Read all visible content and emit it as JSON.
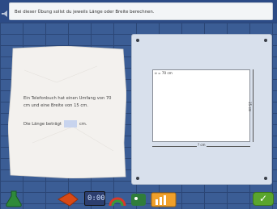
{
  "instruction": "Bei dieser Übung sollst du jeweils Länge oder Breite berechnen.",
  "task": {
    "text": "Ein Telefonbuch hat einen Umfang von 70 cm und eine Breite von 15 cm.",
    "answer_prefix": "Die Länge beträgt",
    "answer_value": "",
    "answer_unit": "cm."
  },
  "drawing": {
    "perimeter_label": "u = 70 cm",
    "width_label": "15 cm",
    "length_label": "? cm"
  },
  "toolbar": {
    "clock_display": "0:00"
  }
}
